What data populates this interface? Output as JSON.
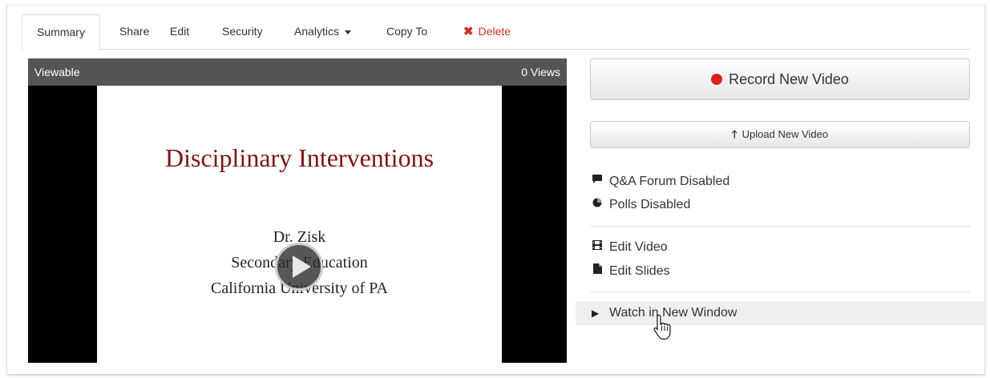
{
  "tabs": {
    "summary": "Summary",
    "share": "Share",
    "edit": "Edit",
    "security": "Security",
    "analytics": "Analytics",
    "copy_to": "Copy To",
    "delete": "Delete"
  },
  "player": {
    "status": "Viewable",
    "views": "0 Views"
  },
  "slide": {
    "title": "Disciplinary Interventions",
    "line1": "Dr. Zisk",
    "line2": "Secondary Education",
    "line3": "California University of PA"
  },
  "actions": {
    "record": "Record New Video",
    "upload": "Upload New Video"
  },
  "menu": {
    "qa_forum": "Q&A Forum Disabled",
    "polls": "Polls Disabled",
    "edit_video": "Edit Video",
    "edit_slides": "Edit Slides",
    "watch": "Watch in New Window"
  },
  "colors": {
    "delete": "#c9302c",
    "record_dot": "#d9231c",
    "slide_title": "#7a1616"
  },
  "icons": [
    "close-icon",
    "caret-down-icon",
    "play-icon",
    "record-dot-icon",
    "upload-arrow-icon",
    "comment-icon",
    "pie-chart-icon",
    "film-icon",
    "file-icon",
    "play-triangle-icon",
    "hand-cursor-icon"
  ]
}
